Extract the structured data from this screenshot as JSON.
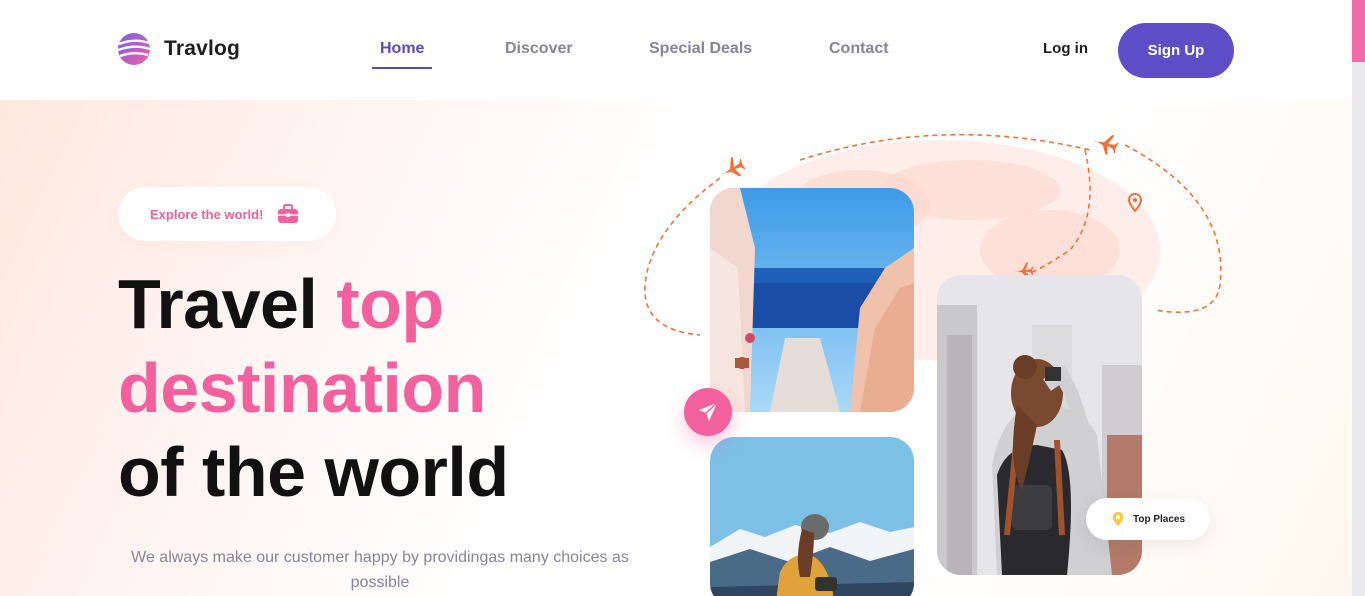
{
  "brand": {
    "name": "Travlog",
    "accent": "#5f4dc8",
    "pink": "#f2609e"
  },
  "nav": {
    "links": [
      {
        "label": "Home",
        "active": true
      },
      {
        "label": "Discover",
        "active": false
      },
      {
        "label": "Special Deals",
        "active": false
      },
      {
        "label": "Contact",
        "active": false
      }
    ],
    "login_label": "Log in",
    "signup_label": "Sign Up"
  },
  "hero": {
    "badge_label": "Explore the world!",
    "headline": {
      "line1_dark": "Travel",
      "line1_pink": "top",
      "line2_pink": "destination",
      "line3_dark": "of the world"
    },
    "subtitle": "We always make our customer happy by providingas many choices as possible"
  },
  "gallery": {
    "top_places_label": "Top Places",
    "icons": [
      "airplane-icon",
      "send-icon",
      "location-pin-icon",
      "briefcase-icon"
    ]
  }
}
